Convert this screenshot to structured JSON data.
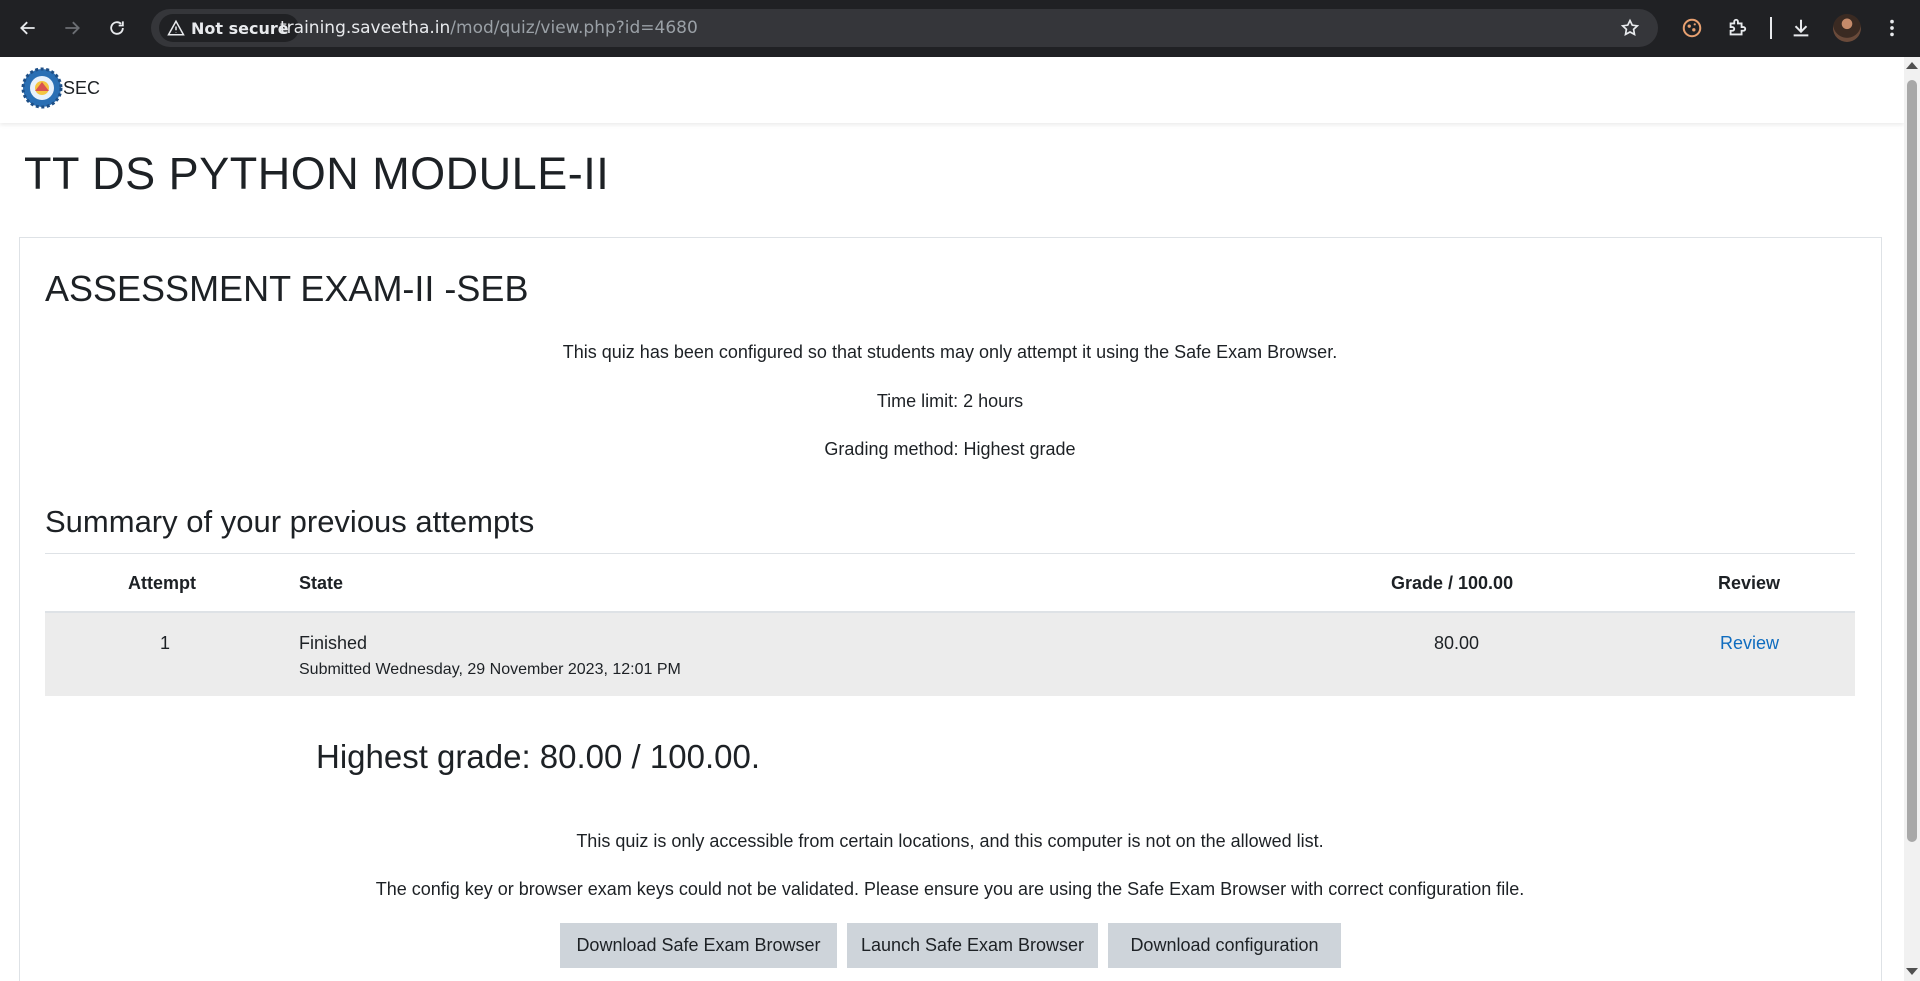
{
  "browser": {
    "security_label": "Not secure",
    "url_host": "training.saveetha.in",
    "url_path": "/mod/quiz/view.php?id=4680"
  },
  "site": {
    "logo_text": "SEC"
  },
  "page": {
    "title": "TT DS PYTHON MODULE-II",
    "quiz_title": "ASSESSMENT EXAM-II -SEB",
    "seb_notice": "This quiz has been configured so that students may only attempt it using the Safe Exam Browser.",
    "time_limit": "Time limit: 2 hours",
    "grading_method": "Grading method: Highest grade",
    "summary_title": "Summary of your previous attempts",
    "highest_grade": "Highest grade: 80.00 / 100.00.",
    "location_notice": "This quiz is only accessible from certain locations, and this computer is not on the allowed list.",
    "config_notice": "The config key or browser exam keys could not be validated. Please ensure you are using the Safe Exam Browser with correct configuration file."
  },
  "attempts_table": {
    "headers": {
      "attempt": "Attempt",
      "state": "State",
      "grade": "Grade / 100.00",
      "review": "Review"
    },
    "rows": [
      {
        "attempt": "1",
        "state": "Finished",
        "submitted": "Submitted Wednesday, 29 November 2023, 12:01 PM",
        "grade": "80.00",
        "review": "Review"
      }
    ]
  },
  "buttons": {
    "download_seb": "Download Safe Exam Browser",
    "launch_seb": "Launch Safe Exam Browser",
    "download_config": "Download configuration"
  },
  "colors": {
    "link": "#0f6cbf",
    "button_bg": "#ced4da",
    "row_bg": "#ececec",
    "chrome_bg": "#202124"
  }
}
